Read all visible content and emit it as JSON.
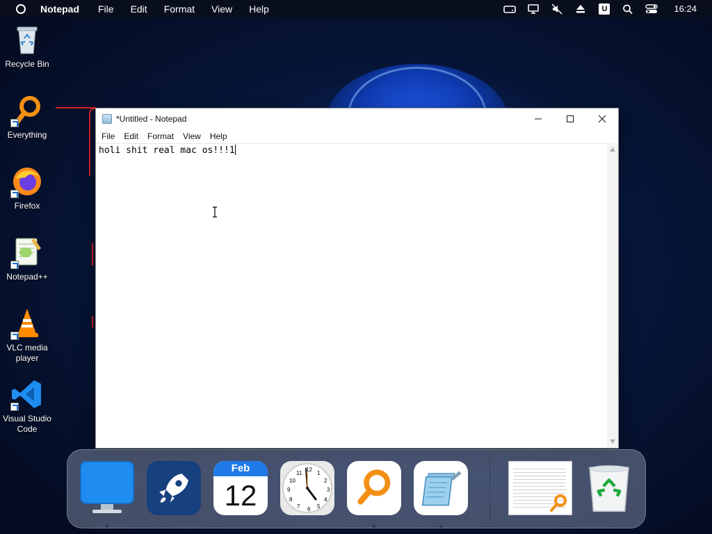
{
  "topbar": {
    "app_name": "Notepad",
    "menus": [
      "File",
      "Edit",
      "Format",
      "View",
      "Help"
    ],
    "tray_icons": [
      "drive-icon",
      "monitor-icon",
      "mute-icon",
      "eject-icon",
      "user-icon",
      "search-icon",
      "control-center-icon"
    ],
    "user_letter": "U",
    "clock": "16:24"
  },
  "desktop_icons": [
    {
      "label": "Recycle Bin",
      "icon": "recycle-bin-icon"
    },
    {
      "label": "Everything",
      "icon": "everything-icon"
    },
    {
      "label": "Firefox",
      "icon": "firefox-icon"
    },
    {
      "label": "Notepad++",
      "icon": "notepadpp-icon"
    },
    {
      "label": "VLC media player",
      "icon": "vlc-icon"
    },
    {
      "label": "Visual Studio Code",
      "icon": "vscode-icon"
    }
  ],
  "notepad": {
    "title": "*Untitled - Notepad",
    "menus": [
      "File",
      "Edit",
      "Format",
      "View",
      "Help"
    ],
    "text": "holi shit real mac os!!!1"
  },
  "dock": {
    "calendar_month": "Feb",
    "calendar_day": "12",
    "clock_numbers": [
      "12",
      "1",
      "2",
      "3",
      "4",
      "5",
      "6",
      "7",
      "8",
      "9",
      "10",
      "11"
    ],
    "items": [
      "finder-icon",
      "launchpad-icon",
      "calendar-icon",
      "clock-icon",
      "everything-icon",
      "notepad-icon",
      "window-preview-icon",
      "trash-icon"
    ]
  },
  "colors": {
    "accent_blue": "#1f8cf0",
    "menubar_bg": "#0a0e1c",
    "annotation_red": "#d8232a"
  }
}
